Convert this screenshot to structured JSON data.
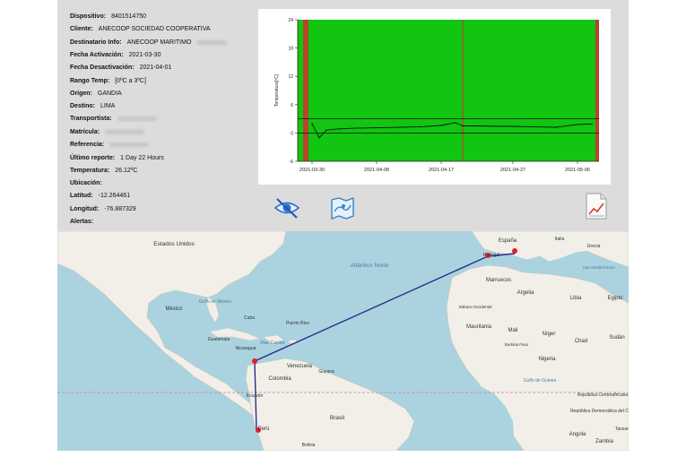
{
  "device": {
    "fields": [
      {
        "label": "Dispositivo:",
        "value": "8401514750"
      },
      {
        "label": "Cliente:",
        "value": "ANECOOP SOCIEDAD COOPERATIVA"
      },
      {
        "label": "Destinatario Info:",
        "value": "ANECOOP MARITIMO"
      },
      {
        "label": "Fecha Activación:",
        "value": "2021-03-30"
      },
      {
        "label": "Fecha Desactivación:",
        "value": "2021-04-01"
      },
      {
        "label": "Rango Temp:",
        "value": "[0ºC a 3ºC]"
      },
      {
        "label": "Origen:",
        "value": "GANDIA"
      },
      {
        "label": "Destino:",
        "value": "LIMA"
      },
      {
        "label": "Transportista:",
        "value": ""
      },
      {
        "label": "Matrícula:",
        "value": ""
      },
      {
        "label": "Referencia:",
        "value": ""
      },
      {
        "label": "Último reporte:",
        "value": "1 Day 22 Hours"
      },
      {
        "label": "Temperatura:",
        "value": "26.12ºC"
      },
      {
        "label": "Ubicación:",
        "value": ""
      },
      {
        "label": "Latitud:",
        "value": "-12.264461"
      },
      {
        "label": "Longitud:",
        "value": "-76.887329"
      },
      {
        "label": "Alertas:",
        "value": ""
      }
    ]
  },
  "chart_data": {
    "type": "line",
    "ylabel": "Temperatura[ºC]",
    "ylim": [
      -6,
      24
    ],
    "yticks": [
      "24",
      "18",
      "12",
      "6",
      "0",
      "-6"
    ],
    "xticks": [
      "2021-03-30",
      "2021-04-08",
      "2021-04-17",
      "2021-04-27",
      "2021-05-06"
    ],
    "threshold_band": [
      0,
      3
    ],
    "series": [
      {
        "x": [
          "2021-03-30",
          "2021-03-31",
          "2021-04-01",
          "2021-04-03",
          "2021-04-05",
          "2021-04-08",
          "2021-04-11",
          "2021-04-14",
          "2021-04-17",
          "2021-04-19",
          "2021-04-20",
          "2021-04-22",
          "2021-04-25",
          "2021-04-27",
          "2021-04-30",
          "2021-05-03",
          "2021-05-06",
          "2021-05-08"
        ],
        "values": [
          2.0,
          -1.0,
          0.6,
          0.9,
          1.0,
          1.1,
          1.2,
          1.3,
          1.6,
          2.2,
          1.5,
          1.5,
          1.4,
          1.4,
          1.3,
          1.2,
          1.8,
          1.9
        ]
      }
    ],
    "background_color": "#11c511",
    "alarm_color": "#b8442c",
    "line_color": "#111111"
  },
  "toolbar": {
    "icons": [
      "eye-off-icon",
      "map-view-icon",
      "chart-report-icon"
    ]
  },
  "map": {
    "labels": {
      "estados_unidos": "Estados Unidos",
      "atlantico_norte": "Atlántico Norte",
      "golfo_mexico": "Golfo de México",
      "mexico": "México",
      "cuba": "Cuba",
      "puerto_rico": "Puerto Rico",
      "guatemala": "Guatemala",
      "nicaragua": "Nicaragua",
      "mar_caribe": "Mar Caribe",
      "venezuela": "Venezuela",
      "colombia": "Colombia",
      "ecuador": "Ecuador",
      "peru": "Perú",
      "brasil": "Brasil",
      "bolivia": "Bolivia",
      "guyana": "Guyana",
      "espana": "España",
      "portugal": "Portugal",
      "marruecos": "Marruecos",
      "argelia": "Argelia",
      "libia": "Libia",
      "egipto": "Egipto",
      "grecia": "Grecia",
      "italia": "Italia",
      "mar_mediterraneo": "Mar Mediterráneo",
      "sahara_occidental": "Sáhara Occidental",
      "mauritania": "Mauritania",
      "mali": "Mali",
      "niger": "Níger",
      "chad": "Chad",
      "sudan": "Sudán",
      "burkina_faso": "Burkina Faso",
      "nigeria": "Nigeria",
      "golfo_guinea": "Golfo de Guinea",
      "rep_centroafricana": "República Centroafricana",
      "rep_congo": "República Democrática del Congo",
      "tanzania": "Tanzania",
      "angola": "Angola",
      "zambia": "Zambia"
    },
    "route_color": "#2c2c8a",
    "marker_color": "#e0202a"
  }
}
